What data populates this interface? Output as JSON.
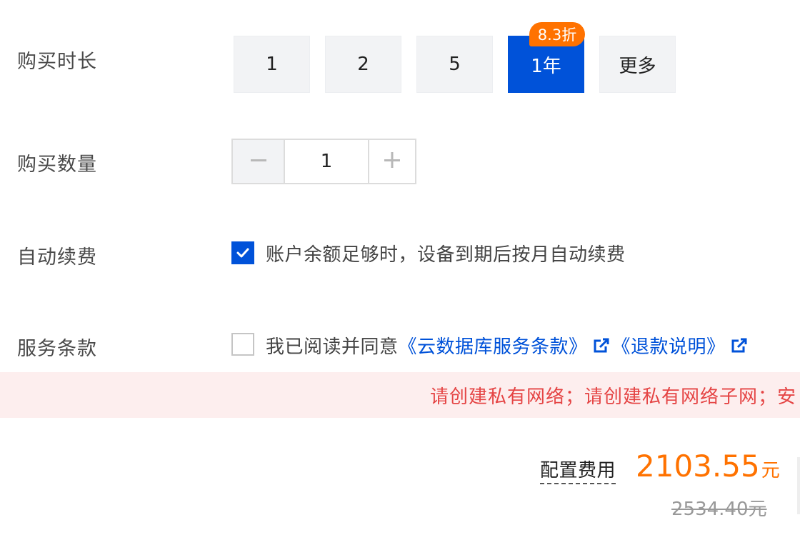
{
  "purchase_duration": {
    "label": "购买时长",
    "options": [
      "1",
      "2",
      "5",
      "1年",
      "更多"
    ],
    "selected": "1年",
    "discount_badge": "8.3折"
  },
  "purchase_quantity": {
    "label": "购买数量",
    "value": "1"
  },
  "auto_renew": {
    "label": "自动续费",
    "checked": true,
    "text": "账户余额足够时，设备到期后按月自动续费"
  },
  "terms": {
    "label": "服务条款",
    "checked": false,
    "prefix": "我已阅读并同意",
    "link1": "《云数据库服务条款》",
    "link2": "《退款说明》"
  },
  "alert": {
    "text": "请创建私有网络；请创建私有网络子网；安"
  },
  "cost": {
    "label": "配置费用",
    "price": "2103.55",
    "unit": "元",
    "original_price": "2534.40元"
  },
  "colors": {
    "accent": "#0052d9",
    "price": "#ff7200",
    "alert_text": "#e54545",
    "alert_bg": "#fdeeee"
  }
}
